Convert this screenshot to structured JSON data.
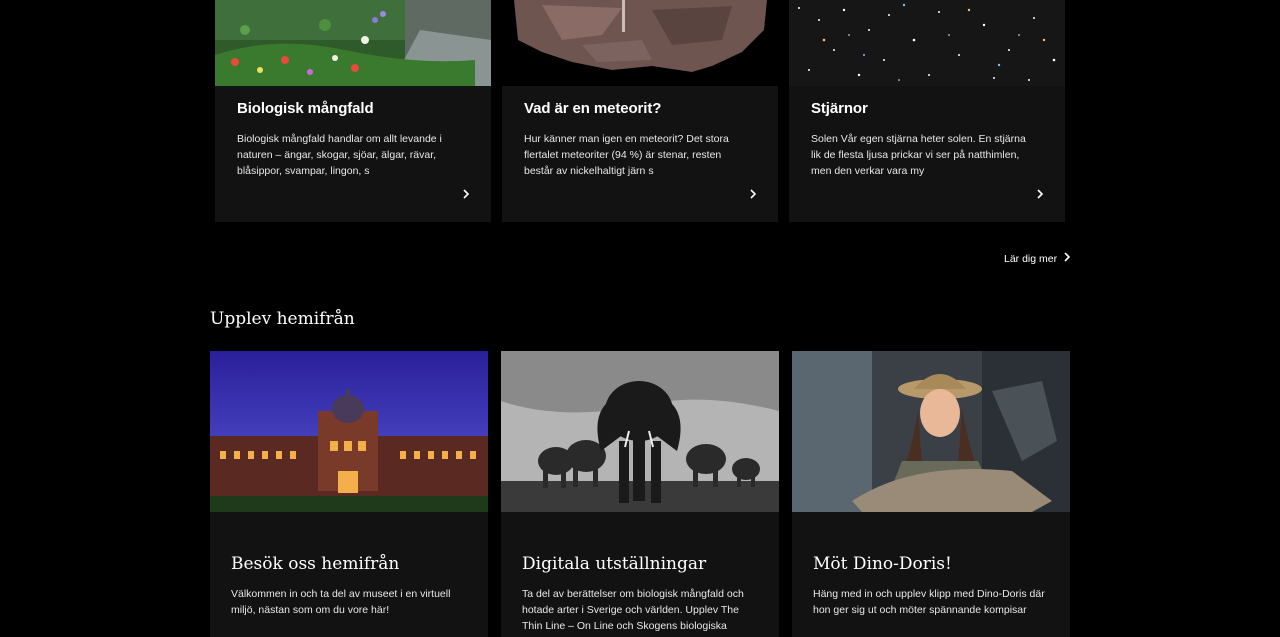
{
  "learn": {
    "cards": [
      {
        "title": "Biologisk mångfald",
        "text": "Biologisk mångfald handlar om allt levande i naturen – ängar, skogar, sjöar, älgar, rävar, blåsippor, svampar, lingon, s",
        "image_icon": "garden-photo",
        "chevron_icon": "chevron-right-icon"
      },
      {
        "title": "Vad är en meteorit?",
        "text": "Hur känner man igen en meteorit? Det stora flertalet meteoriter (94 %) är stenar, resten består av nickelhaltigt järn s",
        "image_icon": "meteorite-photo",
        "chevron_icon": "chevron-right-icon"
      },
      {
        "title": "Stjärnor",
        "text": "Solen Vår egen stjärna heter solen. En stjärna lik de flesta ljusa prickar vi ser på natthimlen, men den verkar vara my",
        "image_icon": "starfield-photo",
        "chevron_icon": "chevron-right-icon"
      }
    ],
    "more_label": "Lär dig mer"
  },
  "experience": {
    "heading": "Upplev hemifrån",
    "cards": [
      {
        "title": "Besök oss hemifrån",
        "text": "Välkommen in och ta del av museet i en virtuell miljö, nästan som om du vore här!",
        "image_icon": "museum-building-photo"
      },
      {
        "title": "Digitala utställningar",
        "text": "Ta del av berättelser om biologisk mångfald och hotade arter i Sverige och världen. Upplev The Thin Line – On Line och Skogens biologiska",
        "image_icon": "elephants-photo"
      },
      {
        "title": "Möt Dino-Doris!",
        "text": "Häng med in och upplev klipp med Dino-Doris där hon ger sig ut och möter spännande kompisar",
        "image_icon": "dino-doris-photo"
      }
    ]
  },
  "colors": {
    "background": "#000000",
    "card": "#121212",
    "text": "#ffffff",
    "body_text": "#e8e8e8"
  }
}
